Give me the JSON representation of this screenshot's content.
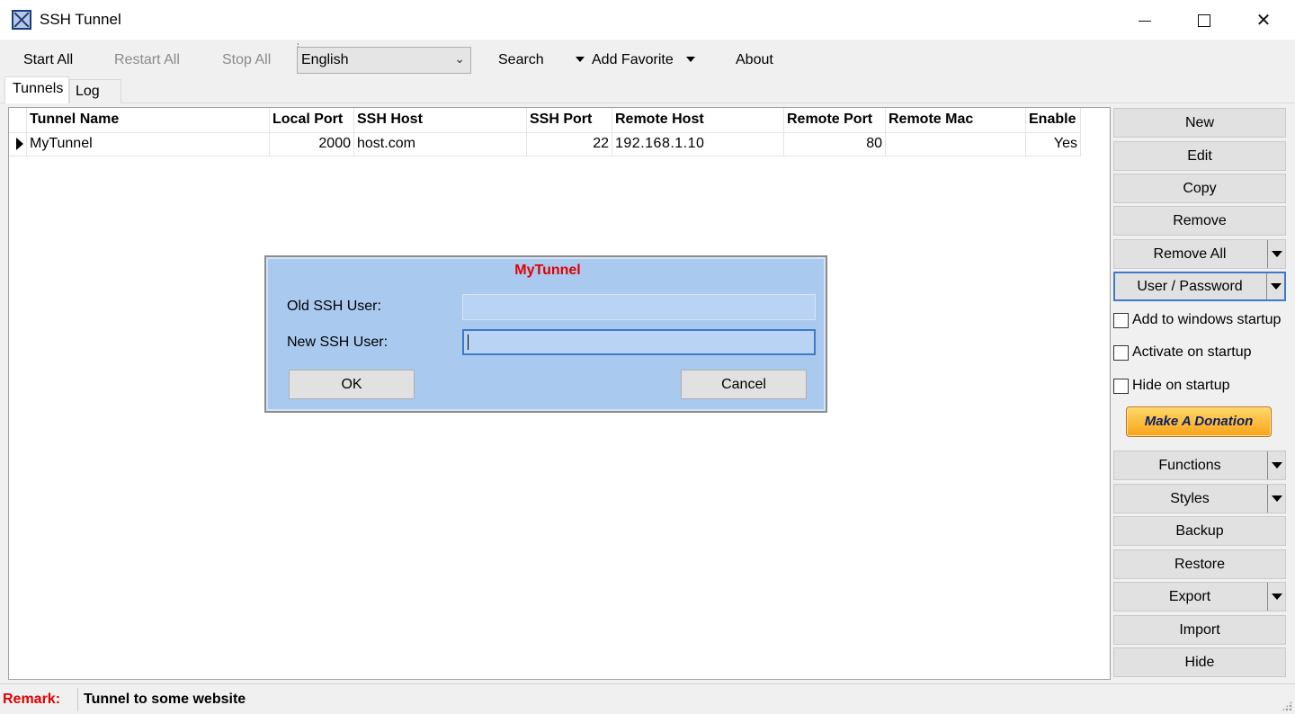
{
  "window": {
    "title": "SSH Tunnel",
    "icon": "ssh-tunnel-app-icon"
  },
  "toolbar": {
    "start_all": "Start All",
    "restart_all": "Restart All",
    "stop_all": "Stop All",
    "language": "English",
    "search": "Search",
    "add_favorite": "Add Favorite",
    "about": "About"
  },
  "tabs": [
    "Tunnels",
    "Log"
  ],
  "grid": {
    "columns": [
      "Tunnel Name",
      "Local Port",
      "SSH Host",
      "SSH Port",
      "Remote Host",
      "Remote Port",
      "Remote Mac",
      "Enable"
    ],
    "rows": [
      {
        "name": "MyTunnel",
        "local_port": "2000",
        "ssh_host": "host.com",
        "ssh_port": "22",
        "remote_host": "192.168.1.10",
        "remote_port": "80",
        "remote_mac": "",
        "enable": "Yes"
      }
    ]
  },
  "dialog": {
    "title": "MyTunnel",
    "old_user_label": "Old SSH User:",
    "old_user_value": "",
    "new_user_label": "New SSH User:",
    "new_user_value": "",
    "ok": "OK",
    "cancel": "Cancel",
    "title_color": "#e00000",
    "background": "#a9c9ef"
  },
  "sidebar": {
    "buttons": {
      "new": "New",
      "edit": "Edit",
      "copy": "Copy",
      "remove": "Remove",
      "remove_all": "Remove All",
      "user_password": "User / Password",
      "functions": "Functions",
      "styles": "Styles",
      "backup": "Backup",
      "restore": "Restore",
      "export": "Export",
      "import": "Import",
      "hide": "Hide"
    },
    "checkboxes": {
      "windows_startup": "Add to windows startup",
      "activate_startup": "Activate on startup",
      "hide_startup": "Hide on startup"
    },
    "donation": "Make A Donation"
  },
  "status": {
    "remark_label": "Remark:",
    "remark_value": "Tunnel to some website"
  }
}
